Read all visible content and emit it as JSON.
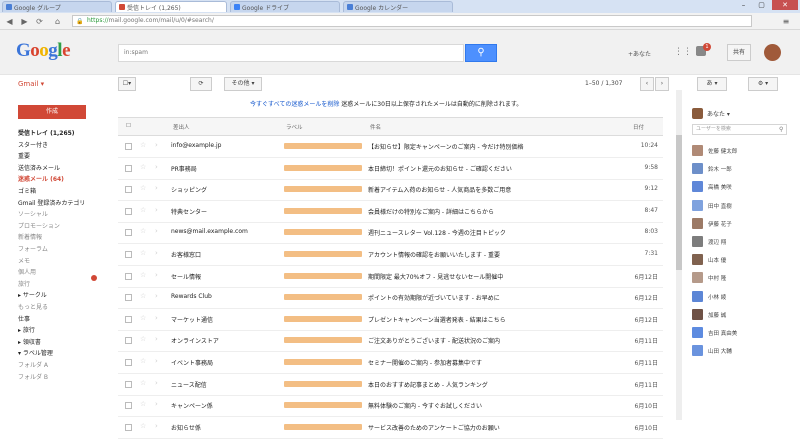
{
  "browser": {
    "tabs": [
      {
        "label": "Google グループ",
        "active": false,
        "favicon_color": "#4a7fd6"
      },
      {
        "label": "受信トレイ (1,265)",
        "active": true,
        "favicon_color": "#d14836"
      },
      {
        "label": "Google ドライブ",
        "active": false,
        "favicon_color": "#3b82f6"
      },
      {
        "label": "Google カレンダー",
        "active": false,
        "favicon_color": "#4a7fd6"
      }
    ],
    "url_scheme": "https://",
    "url_rest": "mail.google.com/mail/u/0/#search/"
  },
  "header": {
    "logo_letters": [
      {
        "ch": "G",
        "color": "#3b75d9"
      },
      {
        "ch": "o",
        "color": "#d9442f"
      },
      {
        "ch": "o",
        "color": "#f0b400"
      },
      {
        "ch": "g",
        "color": "#3b75d9"
      },
      {
        "ch": "l",
        "color": "#2f9e48"
      },
      {
        "ch": "e",
        "color": "#d9442f"
      }
    ],
    "search_value": "in:spam",
    "username": "+あなた",
    "notification_count": "1",
    "share_label": "共有"
  },
  "toolbar": {
    "gmail_label": "Gmail ▾",
    "refresh_icon": "refresh-icon",
    "refresh_label": "⟳",
    "more_label": "その他 ▾",
    "page_range": "1–50 / 1,307",
    "settings_label": "⚙ ▾"
  },
  "sidebar": {
    "compose_label": "作成",
    "items": [
      {
        "label": "受信トレイ (1,265)",
        "style": "bold"
      },
      {
        "label": "スター付き",
        "style": "normal"
      },
      {
        "label": "重要",
        "style": "normal"
      },
      {
        "label": "送信済みメール",
        "style": "normal"
      },
      {
        "label": "迷惑メール (64)",
        "style": "sel"
      },
      {
        "label": "ゴミ箱",
        "style": "normal"
      },
      {
        "label": "Gmail 登録済みカテゴリ",
        "style": "normal"
      },
      {
        "label": "ソーシャル",
        "style": "muted"
      },
      {
        "label": "プロモーション",
        "style": "muted"
      },
      {
        "label": "新着情報",
        "style": "muted"
      },
      {
        "label": "フォーラム",
        "style": "muted"
      },
      {
        "label": "メモ",
        "style": "muted"
      },
      {
        "label": "個人用",
        "style": "muted"
      },
      {
        "label": "旅行",
        "style": "muted"
      },
      {
        "label": "▸ サークル",
        "style": "normal"
      },
      {
        "label": "もっと見る",
        "style": "muted"
      },
      {
        "label": "仕事",
        "style": "normal"
      },
      {
        "label": "▸ 旅行",
        "style": "normal"
      },
      {
        "label": "▸ 領収書",
        "style": "normal"
      },
      {
        "label": "▾ ラベル管理",
        "style": "normal"
      },
      {
        "label": "フォルダ A",
        "style": "muted"
      },
      {
        "label": "フォルダ B",
        "style": "muted"
      }
    ]
  },
  "main": {
    "notice_text": "迷惑メールに30日以上保存されたメールは自動的に削除されます。",
    "notice_link": "今すぐすべての迷惑メールを削除",
    "header": {
      "from": "差出人",
      "label": "ラベル",
      "subject": "件名",
      "date": "日付"
    },
    "rows": [
      {
        "sender": "info@example.jp",
        "subject": "【お知らせ】限定キャンペーンのご案内 - 今だけ特別価格",
        "date": "10:24"
      },
      {
        "sender": "PR事務局",
        "subject": "本日締切！ポイント還元のお知らせ - ご確認ください",
        "date": "9:58"
      },
      {
        "sender": "ショッピング",
        "subject": "新着アイテム入荷のお知らせ - 人気商品を多数ご用意",
        "date": "9:12"
      },
      {
        "sender": "特典センター",
        "subject": "会員様だけの特別なご案内 - 詳細はこちらから",
        "date": "8:47"
      },
      {
        "sender": "news@mail.example.com",
        "subject": "週刊ニュースレター Vol.128 - 今週の注目トピック",
        "date": "8:03"
      },
      {
        "sender": "お客様窓口",
        "subject": "アカウント情報の確認をお願いいたします - 重要",
        "date": "7:31"
      },
      {
        "sender": "セール情報",
        "subject": "期間限定 最大70%オフ - 見逃せないセール開催中",
        "date": "6月12日"
      },
      {
        "sender": "Rewards Club",
        "subject": "ポイントの有効期限が近づいています - お早めに",
        "date": "6月12日"
      },
      {
        "sender": "マーケット通信",
        "subject": "プレゼントキャンペーン当選者発表 - 結果はこちら",
        "date": "6月12日"
      },
      {
        "sender": "オンラインストア",
        "subject": "ご注文ありがとうございます - 配送状況のご案内",
        "date": "6月11日"
      },
      {
        "sender": "イベント事務局",
        "subject": "セミナー開催のご案内 - 参加者募集中です",
        "date": "6月11日"
      },
      {
        "sender": "ニュース配信",
        "subject": "本日のおすすめ記事まとめ - 人気ランキング",
        "date": "6月11日"
      },
      {
        "sender": "キャンペーン係",
        "subject": "無料体験のご案内 - 今すぐお試しください",
        "date": "6月10日"
      },
      {
        "sender": "お知らせ係",
        "subject": "サービス改善のためのアンケートご協力のお願い",
        "date": "6月10日"
      }
    ]
  },
  "chat": {
    "name": "あなた ▾",
    "search_placeholder": "ユーザーを検索",
    "contacts": [
      {
        "name": "佐藤 健太郎",
        "color": "#b08a76"
      },
      {
        "name": "鈴木 一郎",
        "color": "#6d8fc9"
      },
      {
        "name": "高橋 美咲",
        "color": "#5f87d8"
      },
      {
        "name": "田中 直樹",
        "color": "#7fa2de"
      },
      {
        "name": "伊藤 花子",
        "color": "#9c7a66"
      },
      {
        "name": "渡辺 翔",
        "color": "#7d7d7d"
      },
      {
        "name": "山本 優",
        "color": "#80624f"
      },
      {
        "name": "中村 隆",
        "color": "#b59a8a"
      },
      {
        "name": "小林 綾",
        "color": "#5c86d6"
      },
      {
        "name": "加藤 誠",
        "color": "#6f5246"
      },
      {
        "name": "吉田 真由美",
        "color": "#5d8be0"
      },
      {
        "name": "山田 大輔",
        "color": "#6a93de"
      }
    ]
  }
}
